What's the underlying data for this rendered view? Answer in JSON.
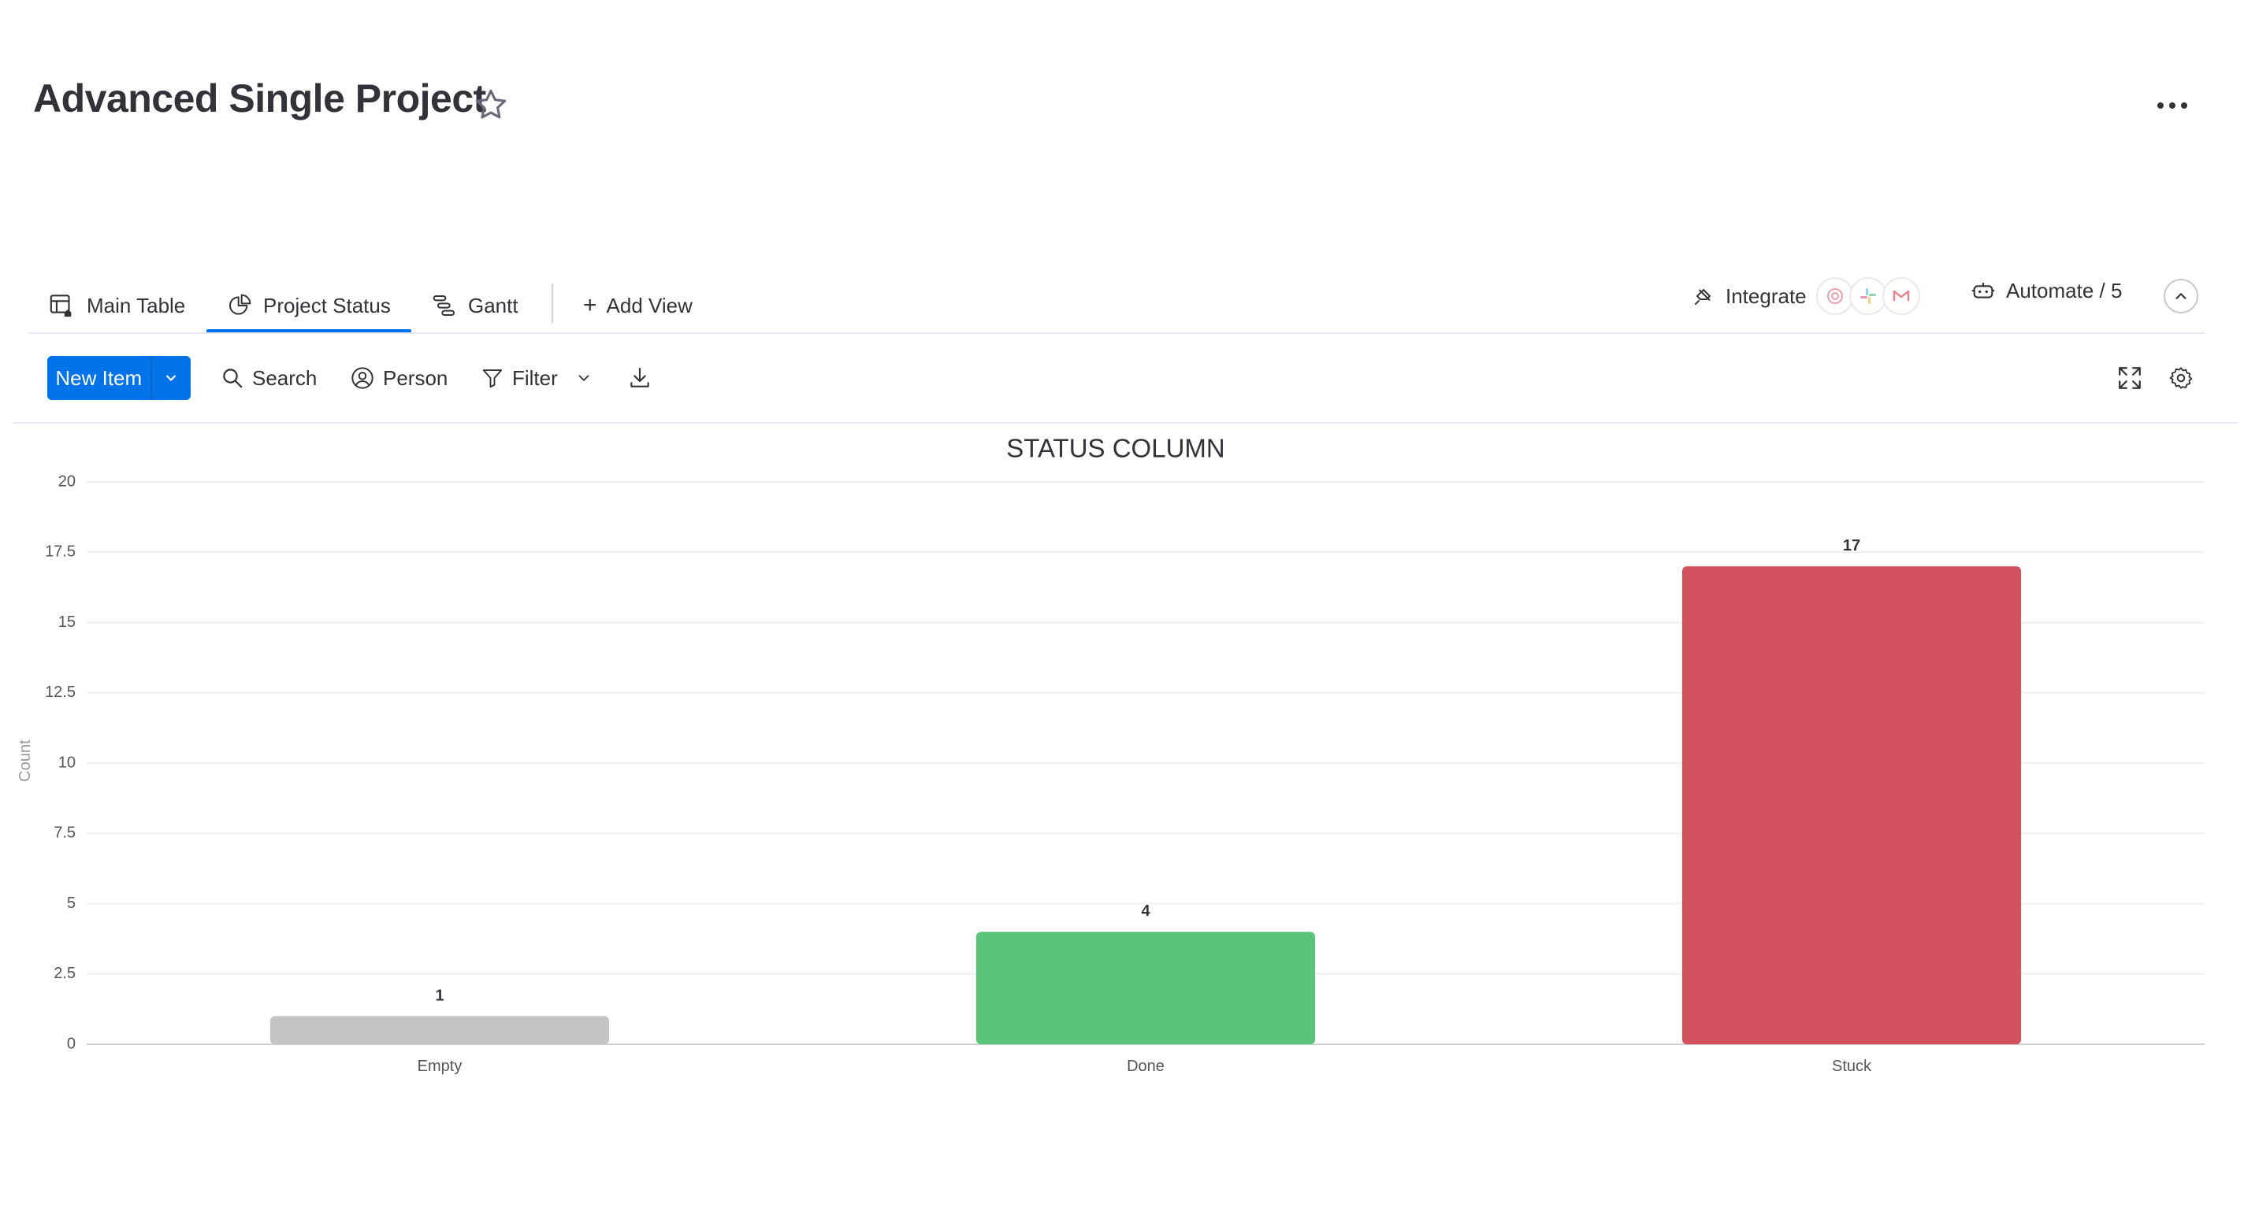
{
  "board": {
    "title": "Advanced Single Project"
  },
  "views": {
    "tabs": [
      {
        "label": "Main Table",
        "icon": "table-home-icon"
      },
      {
        "label": "Project Status",
        "icon": "chart-pie-icon"
      },
      {
        "label": "Gantt",
        "icon": "gantt-icon"
      }
    ],
    "active_tab": "Project Status",
    "add_view_label": "Add View",
    "integrate_label": "Integrate",
    "automate_label": "Automate / 5"
  },
  "toolbar": {
    "new_item_label": "New Item",
    "search_label": "Search",
    "person_label": "Person",
    "filter_label": "Filter"
  },
  "colors": {
    "accent": "#0073ea",
    "empty": "#c4c4c4",
    "done": "#5bc47b",
    "stuck": "#d3525f"
  },
  "chart_data": {
    "type": "bar",
    "title": "STATUS COLUMN",
    "xlabel": "",
    "ylabel": "Count",
    "categories": [
      "Empty",
      "Done",
      "Stuck"
    ],
    "values": [
      1,
      4,
      17
    ],
    "bar_colors": [
      "#c4c4c4",
      "#5bc47b",
      "#d3525f"
    ],
    "ylim": [
      0,
      20
    ],
    "yticks": [
      "0",
      "2.5",
      "5",
      "7.5",
      "10",
      "12.5",
      "15",
      "17.5",
      "20"
    ],
    "grid": true,
    "data_labels": true
  }
}
